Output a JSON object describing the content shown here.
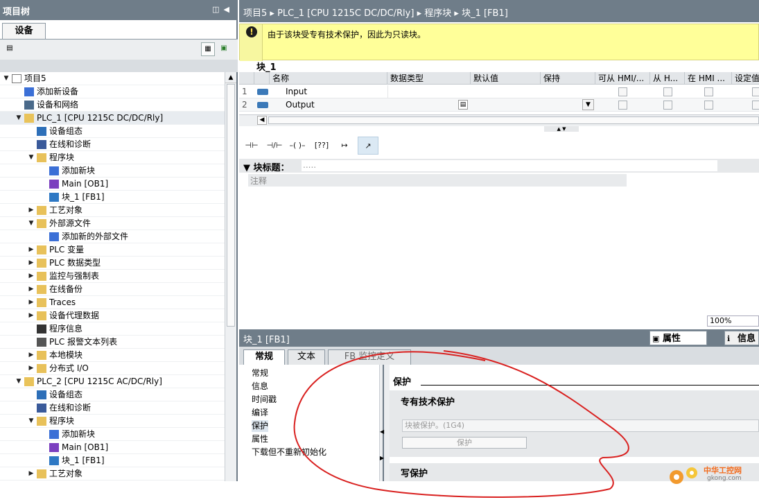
{
  "left_panel": {
    "title": "项目树",
    "tab": "设备",
    "tree": [
      {
        "label": "项目5",
        "level": 0,
        "toggle": "▼",
        "icon": "project-icon"
      },
      {
        "label": "添加新设备",
        "level": 1,
        "toggle": "",
        "icon": "add-device-icon"
      },
      {
        "label": "设备和网络",
        "level": 1,
        "toggle": "",
        "icon": "network-icon"
      },
      {
        "label": "PLC_1 [CPU 1215C DC/DC/Rly]",
        "level": 1,
        "toggle": "▼",
        "icon": "plc-icon",
        "selected": true
      },
      {
        "label": "设备组态",
        "level": 2,
        "toggle": "",
        "icon": "device-config-icon"
      },
      {
        "label": "在线和诊断",
        "level": 2,
        "toggle": "",
        "icon": "diagnostics-icon"
      },
      {
        "label": "程序块",
        "level": 2,
        "toggle": "▼",
        "icon": "folder-icon"
      },
      {
        "label": "添加新块",
        "level": 3,
        "toggle": "",
        "icon": "add-block-icon"
      },
      {
        "label": "Main [OB1]",
        "level": 3,
        "toggle": "",
        "icon": "ob-icon"
      },
      {
        "label": "块_1 [FB1]",
        "level": 3,
        "toggle": "",
        "icon": "fb-icon"
      },
      {
        "label": "工艺对象",
        "level": 2,
        "toggle": "▶",
        "icon": "folder-icon"
      },
      {
        "label": "外部源文件",
        "level": 2,
        "toggle": "▼",
        "icon": "folder-icon"
      },
      {
        "label": "添加新的外部文件",
        "level": 3,
        "toggle": "",
        "icon": "add-file-icon"
      },
      {
        "label": "PLC 变量",
        "level": 2,
        "toggle": "▶",
        "icon": "folder-icon"
      },
      {
        "label": "PLC 数据类型",
        "level": 2,
        "toggle": "▶",
        "icon": "folder-icon"
      },
      {
        "label": "监控与强制表",
        "level": 2,
        "toggle": "▶",
        "icon": "folder-icon"
      },
      {
        "label": "在线备份",
        "level": 2,
        "toggle": "▶",
        "icon": "folder-icon"
      },
      {
        "label": "Traces",
        "level": 2,
        "toggle": "▶",
        "icon": "folder-icon"
      },
      {
        "label": "设备代理数据",
        "level": 2,
        "toggle": "▶",
        "icon": "folder-icon"
      },
      {
        "label": "程序信息",
        "level": 2,
        "toggle": "",
        "icon": "program-info-icon"
      },
      {
        "label": "PLC 报警文本列表",
        "level": 2,
        "toggle": "",
        "icon": "text-list-icon"
      },
      {
        "label": "本地模块",
        "level": 2,
        "toggle": "▶",
        "icon": "folder-icon"
      },
      {
        "label": "分布式 I/O",
        "level": 2,
        "toggle": "▶",
        "icon": "folder-icon"
      },
      {
        "label": "PLC_2 [CPU 1215C AC/DC/Rly]",
        "level": 1,
        "toggle": "▼",
        "icon": "plc-icon"
      },
      {
        "label": "设备组态",
        "level": 2,
        "toggle": "",
        "icon": "device-config-icon"
      },
      {
        "label": "在线和诊断",
        "level": 2,
        "toggle": "",
        "icon": "diagnostics-icon"
      },
      {
        "label": "程序块",
        "level": 2,
        "toggle": "▼",
        "icon": "folder-icon"
      },
      {
        "label": "添加新块",
        "level": 3,
        "toggle": "",
        "icon": "add-block-icon"
      },
      {
        "label": "Main [OB1]",
        "level": 3,
        "toggle": "",
        "icon": "ob-icon"
      },
      {
        "label": "块_1 [FB1]",
        "level": 3,
        "toggle": "",
        "icon": "fb-icon"
      },
      {
        "label": "工艺对象",
        "level": 2,
        "toggle": "▶",
        "icon": "folder-icon"
      }
    ]
  },
  "breadcrumb": [
    "项目5",
    "PLC_1 [CPU 1215C DC/DC/Rly]",
    "程序块",
    "块_1 [FB1]"
  ],
  "info_message": "由于该块受专有技术保护，因此为只读块。",
  "block_name": "块_1",
  "interface": {
    "columns": [
      "名称",
      "数据类型",
      "默认值",
      "保持",
      "可从 HMI/...",
      "从 H...",
      "在 HMI ...",
      "设定值"
    ],
    "rows": [
      {
        "num": "1",
        "name": "Input"
      },
      {
        "num": "2",
        "name": "Output"
      }
    ]
  },
  "ladder_toolbar": [
    "⊣⊢",
    "⊣/⊢",
    "–( )–",
    "[??]",
    "↦",
    "↗"
  ],
  "network": {
    "title": "块标题：",
    "field": ".....",
    "comment": "注释"
  },
  "zoom": "100%",
  "inspector": {
    "title": "块_1 [FB1]",
    "header_tabs": [
      "属性",
      "信息"
    ],
    "tabs": [
      "常规",
      "文本",
      "FB 监控定义"
    ],
    "nav": [
      "常规",
      "信息",
      "时间戳",
      "编译",
      "保护",
      "属性",
      "下载但不重新初始化"
    ],
    "selected_nav": "保护",
    "section_title": "保护",
    "know_how_title": "专有技术保护",
    "protected_field": "块被保护。(1G4)",
    "protect_button": "保护",
    "write_protect_title": "写保护"
  },
  "watermark": {
    "line1": "中华工控网",
    "line2": "gkong.com"
  },
  "colors": {
    "header": "#6f7d89",
    "info": "#ffff99",
    "annotation": "#d9201f",
    "watermark": "#f26a1b"
  }
}
